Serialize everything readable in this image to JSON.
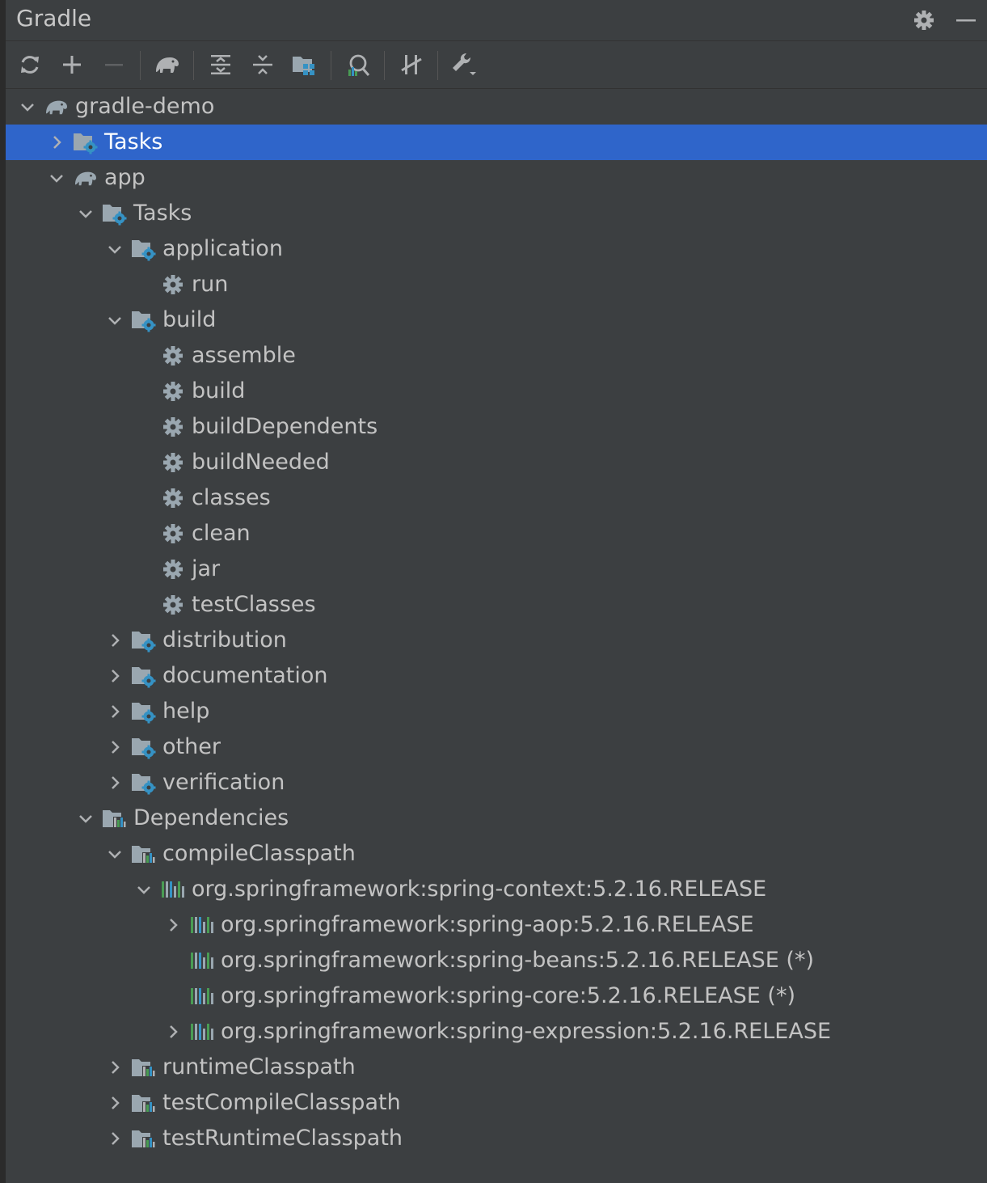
{
  "panel": {
    "title": "Gradle"
  },
  "toolbar": {
    "buttons": [
      {
        "icon": "reload-icon"
      },
      {
        "icon": "plus-icon"
      },
      {
        "icon": "minus-icon"
      },
      {
        "icon": "gradle-elephant-icon"
      },
      {
        "icon": "expand-all-icon"
      },
      {
        "icon": "collapse-all-icon"
      },
      {
        "icon": "group-modules-icon"
      },
      {
        "icon": "analyze-dependencies-icon"
      },
      {
        "icon": "toggle-offline-icon"
      },
      {
        "icon": "build-tool-settings-icon"
      }
    ]
  },
  "header_actions": [
    {
      "icon": "gear-icon"
    },
    {
      "icon": "minimize-icon"
    }
  ],
  "tree": [
    {
      "label": "gradle-demo",
      "icon": "gradle-project-icon",
      "level": 0,
      "state": "expanded"
    },
    {
      "label": "Tasks",
      "icon": "task-folder-icon",
      "level": 1,
      "state": "collapsed",
      "selected": true
    },
    {
      "label": "app",
      "icon": "gradle-project-icon",
      "level": 1,
      "state": "expanded"
    },
    {
      "label": "Tasks",
      "icon": "task-folder-icon",
      "level": 2,
      "state": "expanded"
    },
    {
      "label": "application",
      "icon": "task-folder-icon",
      "level": 3,
      "state": "expanded"
    },
    {
      "label": "run",
      "icon": "task-gear-icon",
      "level": 4,
      "state": "leaf"
    },
    {
      "label": "build",
      "icon": "task-folder-icon",
      "level": 3,
      "state": "expanded"
    },
    {
      "label": "assemble",
      "icon": "task-gear-icon",
      "level": 4,
      "state": "leaf"
    },
    {
      "label": "build",
      "icon": "task-gear-icon",
      "level": 4,
      "state": "leaf"
    },
    {
      "label": "buildDependents",
      "icon": "task-gear-icon",
      "level": 4,
      "state": "leaf"
    },
    {
      "label": "buildNeeded",
      "icon": "task-gear-icon",
      "level": 4,
      "state": "leaf"
    },
    {
      "label": "classes",
      "icon": "task-gear-icon",
      "level": 4,
      "state": "leaf"
    },
    {
      "label": "clean",
      "icon": "task-gear-icon",
      "level": 4,
      "state": "leaf"
    },
    {
      "label": "jar",
      "icon": "task-gear-icon",
      "level": 4,
      "state": "leaf"
    },
    {
      "label": "testClasses",
      "icon": "task-gear-icon",
      "level": 4,
      "state": "leaf"
    },
    {
      "label": "distribution",
      "icon": "task-folder-icon",
      "level": 3,
      "state": "collapsed"
    },
    {
      "label": "documentation",
      "icon": "task-folder-icon",
      "level": 3,
      "state": "collapsed"
    },
    {
      "label": "help",
      "icon": "task-folder-icon",
      "level": 3,
      "state": "collapsed"
    },
    {
      "label": "other",
      "icon": "task-folder-icon",
      "level": 3,
      "state": "collapsed"
    },
    {
      "label": "verification",
      "icon": "task-folder-icon",
      "level": 3,
      "state": "collapsed"
    },
    {
      "label": "Dependencies",
      "icon": "dependencies-folder-icon",
      "level": 2,
      "state": "expanded"
    },
    {
      "label": "compileClasspath",
      "icon": "dependencies-folder-icon",
      "level": 3,
      "state": "expanded"
    },
    {
      "label": "org.springframework:spring-context:5.2.16.RELEASE",
      "icon": "library-icon",
      "level": 4,
      "state": "expanded"
    },
    {
      "label": "org.springframework:spring-aop:5.2.16.RELEASE",
      "icon": "library-icon",
      "level": 5,
      "state": "collapsed"
    },
    {
      "label": "org.springframework:spring-beans:5.2.16.RELEASE (*)",
      "icon": "library-icon",
      "level": 5,
      "state": "leaf"
    },
    {
      "label": "org.springframework:spring-core:5.2.16.RELEASE (*)",
      "icon": "library-icon",
      "level": 5,
      "state": "leaf"
    },
    {
      "label": "org.springframework:spring-expression:5.2.16.RELEASE",
      "icon": "library-icon",
      "level": 5,
      "state": "collapsed"
    },
    {
      "label": "runtimeClasspath",
      "icon": "dependencies-folder-icon",
      "level": 3,
      "state": "collapsed"
    },
    {
      "label": "testCompileClasspath",
      "icon": "dependencies-folder-icon",
      "level": 3,
      "state": "collapsed"
    },
    {
      "label": "testRuntimeClasspath",
      "icon": "dependencies-folder-icon",
      "level": 3,
      "state": "collapsed"
    }
  ],
  "colors": {
    "background": "#3c3f41",
    "selection": "#2f65ca",
    "text": "#c3c3c3",
    "accent_blue": "#3592c4",
    "accent_green": "#499c54"
  }
}
